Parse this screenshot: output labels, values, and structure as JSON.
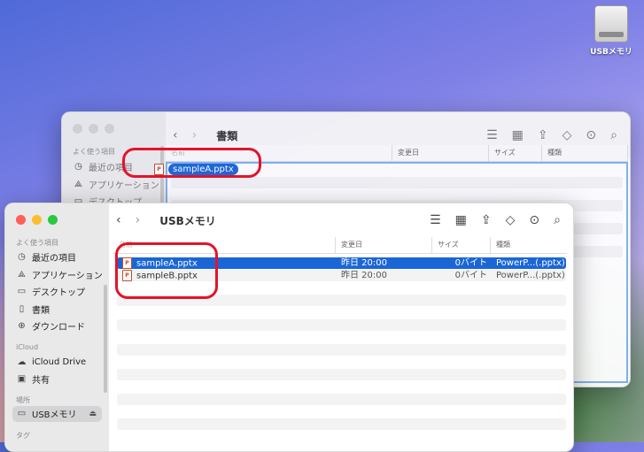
{
  "desktop": {
    "drive_label": "USBメモリ"
  },
  "back_window": {
    "title": "書類",
    "sidebar": {
      "section": "よく使う項目",
      "items": [
        {
          "label": "最近の項目",
          "icon": "clock-icon"
        },
        {
          "label": "アプリケーション",
          "icon": "apps-icon"
        },
        {
          "label": "デスクトップ",
          "icon": "desktop-icon"
        }
      ]
    },
    "columns": [
      "名前",
      "変更日",
      "サイズ",
      "種類"
    ],
    "dragged_file": "sampleA.pptx"
  },
  "front_window": {
    "title": "USBメモリ",
    "sidebar": {
      "favorites_header": "よく使う項目",
      "favorites": [
        {
          "label": "最近の項目",
          "icon": "clock-icon"
        },
        {
          "label": "アプリケーション",
          "icon": "apps-icon"
        },
        {
          "label": "デスクトップ",
          "icon": "desktop-icon"
        },
        {
          "label": "書類",
          "icon": "document-icon"
        },
        {
          "label": "ダウンロード",
          "icon": "download-icon"
        }
      ],
      "icloud_header": "iCloud",
      "icloud": [
        {
          "label": "iCloud Drive",
          "icon": "cloud-icon"
        },
        {
          "label": "共有",
          "icon": "shared-folder-icon"
        }
      ],
      "locations_header": "場所",
      "locations": [
        {
          "label": "USBメモリ",
          "icon": "drive-icon"
        }
      ],
      "tags_header": "タグ"
    },
    "columns": [
      "名前",
      "変更日",
      "サイズ",
      "種類"
    ],
    "files": [
      {
        "name": "sampleA.pptx",
        "date": "昨日 20:00",
        "size": "0バイト",
        "kind": "PowerP...(.pptx)",
        "selected": true
      },
      {
        "name": "sampleB.pptx",
        "date": "昨日 20:00",
        "size": "0バイト",
        "kind": "PowerP...(.pptx)",
        "selected": false
      }
    ]
  },
  "colors": {
    "accent": "#1a66d6",
    "annotation": "#e3132a",
    "close": "#ff5f57",
    "minimize": "#febc2e",
    "zoom": "#28c840"
  }
}
